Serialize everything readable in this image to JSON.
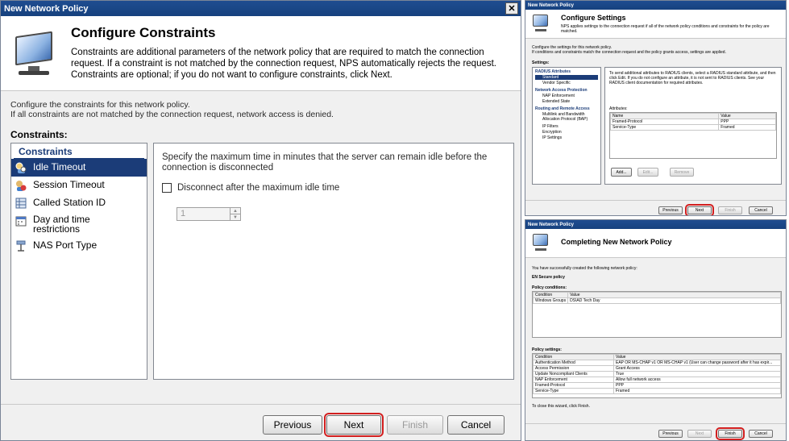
{
  "main": {
    "window_title": "New Network Policy",
    "header": {
      "title": "Configure Constraints",
      "description": "Constraints are additional parameters of the network policy that are required to match the connection request. If a constraint is not matched by the connection request, NPS automatically rejects the request. Constraints are optional; if you do not want to configure constraints, click Next."
    },
    "intro_line1": "Configure the constraints for this network policy.",
    "intro_line2": "If all constraints are not matched by the connection request, network access is denied.",
    "constraints_label": "Constraints:",
    "nav_header": "Constraints",
    "nav_items": [
      {
        "label": "Idle Timeout",
        "icon": "clock-user-icon",
        "selected": true
      },
      {
        "label": "Session Timeout",
        "icon": "timer-user-icon",
        "selected": false
      },
      {
        "label": "Called Station ID",
        "icon": "grid-icon",
        "selected": false
      },
      {
        "label": "Day and time restrictions",
        "icon": "calendar-icon",
        "selected": false
      },
      {
        "label": "NAS Port Type",
        "icon": "network-port-icon",
        "selected": false
      }
    ],
    "detail": {
      "description": "Specify the maximum time in minutes that the server can remain idle before the connection is disconnected",
      "checkbox_label": "Disconnect after the maximum idle time",
      "spinner_value": "1"
    },
    "buttons": {
      "previous": "Previous",
      "next": "Next",
      "finish": "Finish",
      "cancel": "Cancel"
    },
    "highlight_color": "#d21f1f"
  },
  "settings": {
    "window_title": "New Network Policy",
    "header_title": "Configure Settings",
    "header_desc": "NPS applies settings to the connection request if all of the network policy conditions and constraints for the policy are matched.",
    "intro_line1": "Configure the settings for this network policy.",
    "intro_line2": "If conditions and constraints match the connection request and the policy grants access, settings are applied.",
    "settings_label": "Settings:",
    "sections": [
      {
        "header": "RADIUS Attributes",
        "items": [
          "Standard",
          "Vendor Specific"
        ]
      },
      {
        "header": "Network Access Protection",
        "items": [
          "NAP Enforcement",
          "Extended State"
        ]
      },
      {
        "header": "Routing and Remote Access",
        "items": [
          "Multilink and Bandwidth Allocation Protocol (BAP)",
          "IP Filters",
          "Encryption",
          "IP Settings"
        ]
      }
    ],
    "detail_desc": "To send additional attributes to RADIUS clients, select a RADIUS standard attribute, and then click Edit. If you do not configure an attribute, it is not sent to RADIUS clients. See your RADIUS client documentation for required attributes.",
    "attributes_label": "Attributes:",
    "attr_columns": [
      "Name",
      "Value"
    ],
    "attr_rows": [
      [
        "Framed-Protocol",
        "PPP"
      ],
      [
        "Service-Type",
        "Framed"
      ]
    ],
    "attr_buttons": [
      "Add...",
      "Edit...",
      "Remove"
    ],
    "buttons": {
      "previous": "Previous",
      "next": "Next",
      "finish": "Finish",
      "cancel": "Cancel"
    }
  },
  "completing": {
    "window_title": "New Network Policy",
    "header_title": "Completing New Network Policy",
    "created_line": "You have successfully created the following network policy:",
    "policy_name": "EN Secure policy",
    "conditions_label": "Policy conditions:",
    "cond_columns": [
      "Condition",
      "Value"
    ],
    "cond_rows": [
      [
        "Windows Groups",
        "DS\\AD Tech Day"
      ]
    ],
    "settings_label": "Policy settings:",
    "set_columns": [
      "Condition",
      "Value"
    ],
    "set_rows": [
      [
        "Authentication Method",
        "EAP OR MS-CHAP v1 OR MS-CHAP v1 (User can change password after it has expir..."
      ],
      [
        "Access Permission",
        "Grant Access"
      ],
      [
        "Update Noncompliant Clients",
        "True"
      ],
      [
        "NAP Enforcement",
        "Allow full network access"
      ],
      [
        "Framed-Protocol",
        "PPP"
      ],
      [
        "Service-Type",
        "Framed"
      ]
    ],
    "close_line": "To close this wizard, click Finish.",
    "buttons": {
      "previous": "Previous",
      "next": "Next",
      "finish": "Finish",
      "cancel": "Cancel"
    }
  }
}
